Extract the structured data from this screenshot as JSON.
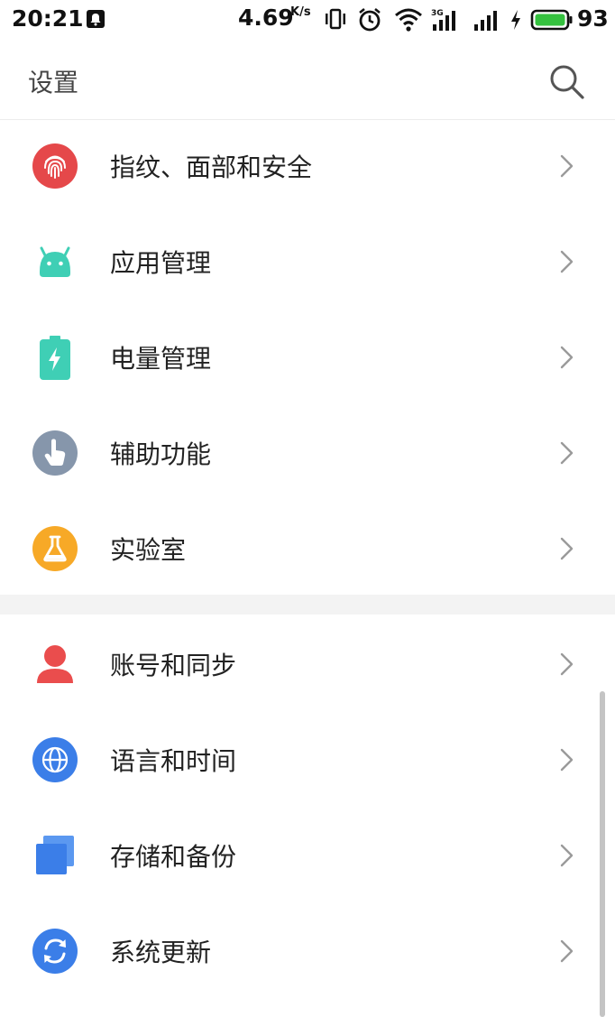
{
  "status_bar": {
    "time": "20:21",
    "net_speed": "4.69",
    "net_speed_unit": "K/s",
    "network_type": "3G",
    "battery_level": "93",
    "battery_color": "#35c13f"
  },
  "header": {
    "title": "设置"
  },
  "group1": [
    {
      "label": "指纹、面部和安全",
      "icon": "fingerprint-icon",
      "color": "#e5484a"
    },
    {
      "label": "应用管理",
      "icon": "android-icon",
      "color": "#3fcfb5"
    },
    {
      "label": "电量管理",
      "icon": "battery-icon",
      "color": "#3fcfb5"
    },
    {
      "label": "辅助功能",
      "icon": "touch-hand-icon",
      "color": "#8696ab"
    },
    {
      "label": "实验室",
      "icon": "flask-icon",
      "color": "#f7a927"
    }
  ],
  "group2": [
    {
      "label": "账号和同步",
      "icon": "account-icon",
      "color": "#ea4d4d"
    },
    {
      "label": "语言和时间",
      "icon": "globe-icon",
      "color": "#3b7ee8"
    },
    {
      "label": "存储和备份",
      "icon": "storage-icon",
      "color": "#3b7ee8"
    },
    {
      "label": "系统更新",
      "icon": "update-icon",
      "color": "#3b7ee8"
    }
  ]
}
